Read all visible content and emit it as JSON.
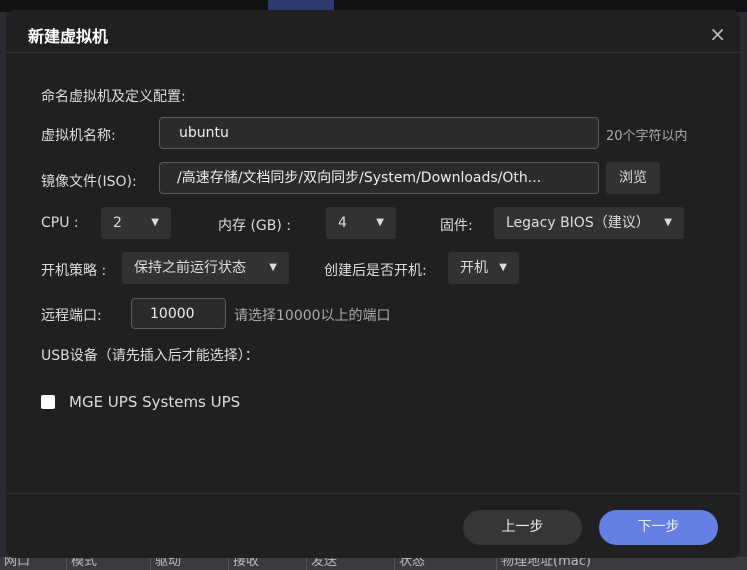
{
  "dialog": {
    "title": "新建虚拟机",
    "close": "×"
  },
  "form": {
    "section": "命名虚拟机及定义配置:",
    "name_label": "虚拟机名称:",
    "name_value": "ubuntu",
    "name_hint": "20个字符以内",
    "iso_label": "镜像文件(ISO):",
    "iso_value": "/高速存储/文档同步/双向同步/System/Downloads/Oth...",
    "browse": "浏览",
    "cpu_label": "CPU :",
    "cpu_value": "2",
    "mem_label": "内存 (GB) :",
    "mem_value": "4",
    "fw_label": "固件:",
    "fw_value": "Legacy BIOS（建议）",
    "boot_label": "开机策略 :",
    "boot_value": "保持之前运行状态",
    "start_label": "创建后是否开机:",
    "start_value": "开机",
    "port_label": "远程端口:",
    "port_value": "10000",
    "port_hint": "请选择10000以上的端口",
    "usb_label": "USB设备（请先插入后才能选择）：",
    "usb_device": "MGE UPS Systems UPS"
  },
  "footer": {
    "prev": "上一步",
    "next": "下一步"
  },
  "background_table": [
    "网口",
    "模式",
    "驱动",
    "接收",
    "发送",
    "状态",
    "物理地址(mac)"
  ],
  "colors": {
    "primary": "#6480e4",
    "dialog": "#202020"
  }
}
